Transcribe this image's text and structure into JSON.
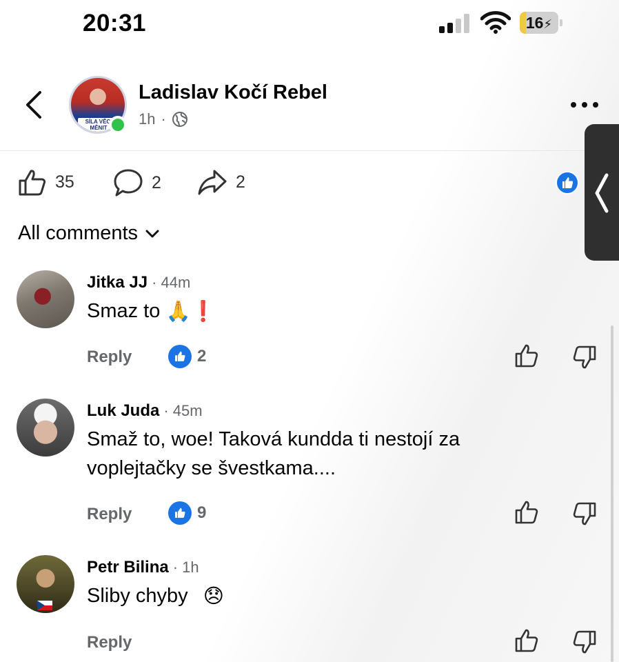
{
  "status_bar": {
    "time": "20:31",
    "battery": "16"
  },
  "post": {
    "author": "Ladislav Kočí Rebel",
    "age": "1h",
    "separator": "·",
    "avatar_badge": "SÍLA VĚCI MĚNIT",
    "likes": "35",
    "comments": "2",
    "shares": "2"
  },
  "comments_header": {
    "label": "All comments"
  },
  "comments": [
    {
      "name": "Jitka JJ",
      "time": "· 44m",
      "text": "Smaz to",
      "emoji": "🙏❗",
      "reply": "Reply",
      "likes": "2"
    },
    {
      "name": "Luk Juda",
      "time": "· 45m",
      "text": "Smaž to, woe! Taková kundda ti nestojí za voplejtačky se švestkama....",
      "reply": "Reply",
      "likes": "9"
    },
    {
      "name": "Petr Bilina",
      "time": "· 1h",
      "text": "Sliby chyby",
      "emoji": "😞",
      "reply": "Reply"
    }
  ],
  "colors": {
    "accent": "#1b74e4",
    "online": "#31c24c",
    "battery": "#f2c744",
    "muted": "#65676b"
  }
}
